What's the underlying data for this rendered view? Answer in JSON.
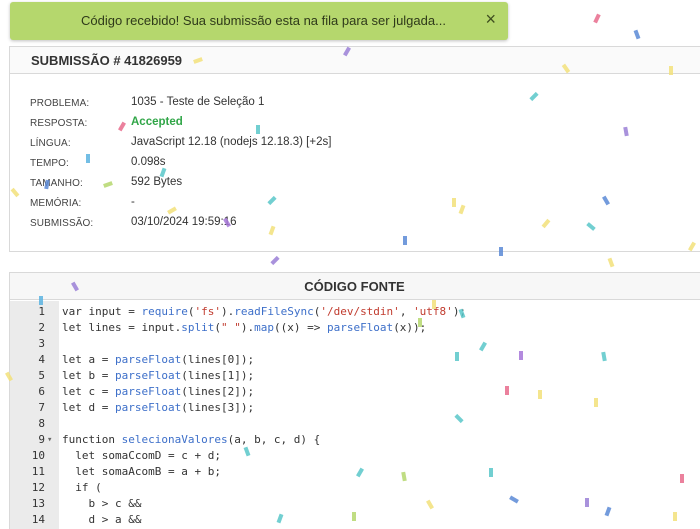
{
  "toast": {
    "message": "Código recebido! Sua submissão esta na fila para ser julgada...",
    "close_label": "×"
  },
  "submission": {
    "title": "SUBMISSÃO # 41826959",
    "fields": [
      {
        "label": "PROBLEMA:",
        "value": "1035 - Teste de Seleção 1"
      },
      {
        "label": "RESPOSTA:",
        "value": "Accepted"
      },
      {
        "label": "LÍNGUA:",
        "value": "JavaScript 12.18 (nodejs 12.18.3) [+2s]"
      },
      {
        "label": "TEMPO:",
        "value": "0.098s"
      },
      {
        "label": "TAMANHO:",
        "value": "592 Bytes"
      },
      {
        "label": "MEMÓRIA:",
        "value": "-"
      },
      {
        "label": "SUBMISSÃO:",
        "value": "03/10/2024 19:59:16"
      }
    ]
  },
  "source": {
    "title": "CÓDIGO FONTE",
    "lines": [
      {
        "n": "1",
        "code": "var input = require('fs').readFileSync('/dev/stdin', 'utf8');"
      },
      {
        "n": "2",
        "code": "let lines = input.split(\" \").map((x) => parseFloat(x));"
      },
      {
        "n": "3",
        "code": ""
      },
      {
        "n": "4",
        "code": "let a = parseFloat(lines[0]);"
      },
      {
        "n": "5",
        "code": "let b = parseFloat(lines[1]);"
      },
      {
        "n": "6",
        "code": "let c = parseFloat(lines[2]);"
      },
      {
        "n": "7",
        "code": "let d = parseFloat(lines[3]);"
      },
      {
        "n": "8",
        "code": ""
      },
      {
        "n": "9",
        "code": "function selecionaValores(a, b, c, d) {",
        "fold": "▾"
      },
      {
        "n": "10",
        "code": "  let somaCcomD = c + d;"
      },
      {
        "n": "11",
        "code": "  let somaAcomB = a + b;"
      },
      {
        "n": "12",
        "code": "  if ("
      },
      {
        "n": "13",
        "code": "    b > c &&"
      },
      {
        "n": "14",
        "code": "    d > a &&"
      }
    ]
  },
  "colors": {
    "toast_bg": "#b5d76d",
    "accepted": "#31a648",
    "gutter_bg": "#ebebeb"
  }
}
